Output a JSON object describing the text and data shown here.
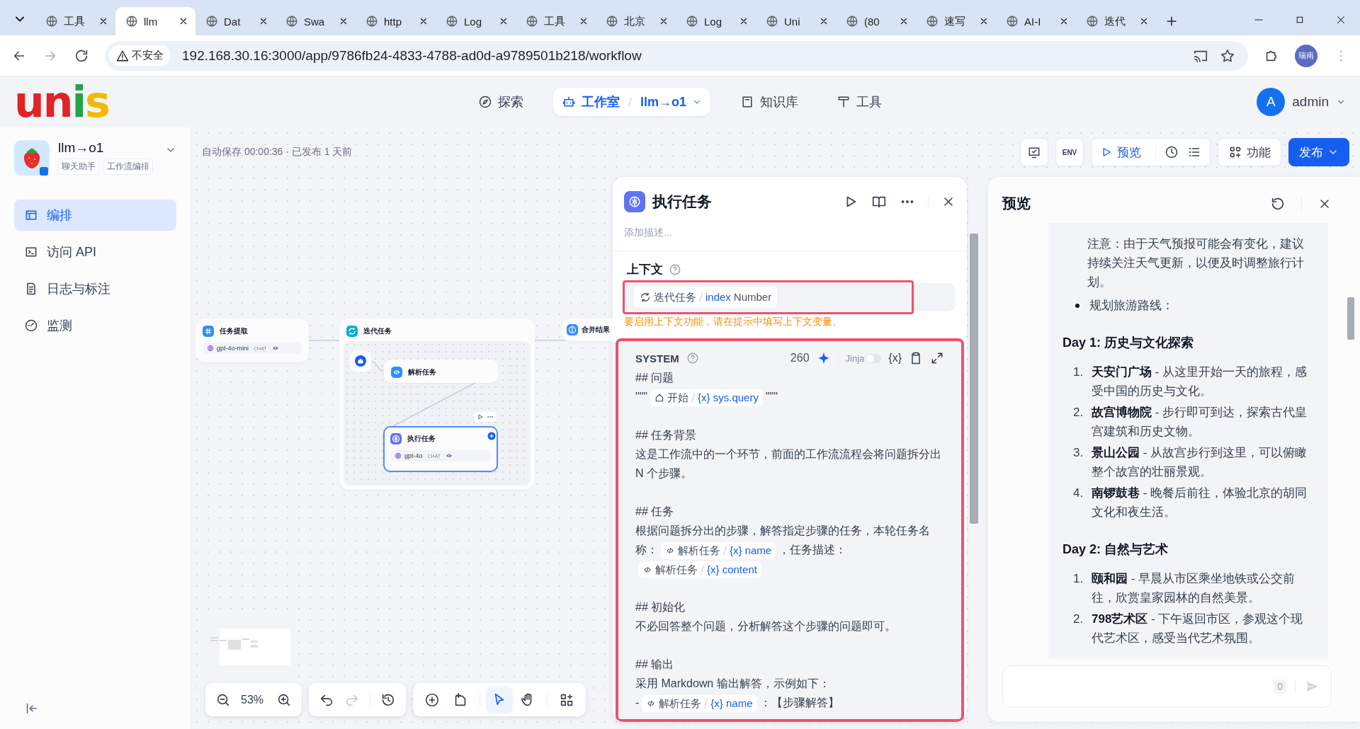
{
  "browser": {
    "tabs": [
      {
        "title": "工具",
        "selected": false
      },
      {
        "title": "llm",
        "selected": true
      },
      {
        "title": "Dat",
        "selected": false
      },
      {
        "title": "Swa",
        "selected": false
      },
      {
        "title": "http",
        "selected": false
      },
      {
        "title": "Log",
        "selected": false
      },
      {
        "title": "工具",
        "selected": false
      },
      {
        "title": "北京",
        "selected": false
      },
      {
        "title": "Log",
        "selected": false
      },
      {
        "title": "Uni",
        "selected": false
      },
      {
        "title": "(80",
        "selected": false
      },
      {
        "title": "速写",
        "selected": false
      },
      {
        "title": "AI-I",
        "selected": false
      },
      {
        "title": "迭代",
        "selected": false
      }
    ],
    "security": "不安全",
    "url": "192.168.30.16:3000/app/9786fb24-4833-4788-ad0d-a9789501b218/workflow",
    "profile": "瑞南"
  },
  "header": {
    "logo": "unis",
    "nav": [
      {
        "label": "探索",
        "selected": false
      },
      {
        "label": "工作室",
        "selected": true,
        "app": "llm→o1"
      },
      {
        "label": "知识库",
        "selected": false
      },
      {
        "label": "工具",
        "selected": false
      }
    ],
    "user": {
      "initial": "A",
      "name": "admin"
    }
  },
  "sidebar": {
    "app": {
      "name": "llm→o1",
      "tags": [
        "聊天助手",
        "工作流编排"
      ]
    },
    "items": [
      {
        "label": "编排",
        "selected": true
      },
      {
        "label": "访问 API",
        "selected": false
      },
      {
        "label": "日志与标注",
        "selected": false
      },
      {
        "label": "监测",
        "selected": false
      }
    ]
  },
  "toolbar": {
    "autosave": "自动保存 00:00:36 · 已发布 1 天前",
    "env": "ENV",
    "preview": "预览",
    "features": "功能",
    "publish": "发布"
  },
  "workflow": {
    "nodes": [
      {
        "kind": "extract",
        "title": "任务提取",
        "model": "gpt-4o-mini",
        "badge": "CHAT",
        "selected": false
      },
      {
        "kind": "iteration",
        "title": "迭代任务",
        "selected": false,
        "children": [
          {
            "kind": "start",
            "selected": false
          },
          {
            "kind": "code",
            "title": "解析任务",
            "selected": false
          },
          {
            "kind": "llm",
            "title": "执行任务",
            "model": "gpt-4o",
            "badge": "CHAT",
            "selected": true
          }
        ]
      },
      {
        "kind": "merge",
        "title": "合并结果",
        "selected": false
      }
    ]
  },
  "canvas_controls": {
    "zoom": "53%",
    "history": [
      {
        "kind": "undo",
        "disabled": false
      },
      {
        "kind": "redo",
        "disabled": true
      },
      {
        "kind": "history",
        "disabled": false
      }
    ],
    "tools": [
      {
        "kind": "add",
        "selected": false
      },
      {
        "kind": "note",
        "selected": false
      },
      {
        "kind": "pointer",
        "selected": true
      },
      {
        "kind": "hand",
        "selected": false
      },
      {
        "kind": "layout",
        "selected": false
      }
    ]
  },
  "panel": {
    "title": "执行任务",
    "description": {
      "placeholder": "添加描述..."
    },
    "context": {
      "label": "上下文",
      "highlighted": true,
      "variable": {
        "node": "迭代任务",
        "name": "index",
        "type": "Number"
      }
    },
    "warning": "要启用上下文功能，请在提示中填写上下文变量。",
    "prompt": {
      "role": "SYSTEM",
      "count": "260",
      "jinja": {
        "label": "Jinja",
        "on": false
      },
      "insert_label": "{x}",
      "highlighted": true,
      "sections": [
        {
          "heading": "## 问题",
          "lines": [
            [
              {
                "kind": "text",
                "text": "\"\"\""
              },
              {
                "kind": "start_var",
                "node": "开始",
                "mark": "{x}",
                "name": "sys.query"
              },
              {
                "kind": "text",
                "text": "\"\"\""
              }
            ]
          ]
        },
        {
          "heading": "## 任务背景",
          "lines": [
            [
              {
                "kind": "text",
                "text": "这是工作流中的一个环节，前面的工作流流程会将问题拆分出 N 个步骤。"
              }
            ]
          ]
        },
        {
          "heading": "## 任务",
          "lines": [
            [
              {
                "kind": "text",
                "text": "根据问题拆分出的步骤，解答指定步骤的任务，本轮任务名称："
              },
              {
                "kind": "code_var",
                "node": "解析任务",
                "mark": "{x}",
                "name": "name"
              },
              {
                "kind": "text",
                "text": "，任务描述："
              },
              {
                "kind": "code_var",
                "node": "解析任务",
                "mark": "{x}",
                "name": "content"
              }
            ]
          ]
        },
        {
          "heading": "## 初始化",
          "lines": [
            [
              {
                "kind": "text",
                "text": "不必回答整个问题，分析解答这个步骤的问题即可。"
              }
            ]
          ]
        },
        {
          "heading": "## 输出",
          "lines": [
            [
              {
                "kind": "text",
                "text": "采用 Markdown 输出解答，示例如下："
              }
            ],
            [
              {
                "kind": "text",
                "text": "-"
              },
              {
                "kind": "code_var",
                "node": "解析任务",
                "mark": "{x}",
                "name": "name"
              },
              {
                "kind": "text",
                "text": "：【步骤解答】"
              }
            ]
          ]
        }
      ]
    }
  },
  "preview": {
    "title": "预览",
    "blocks": [
      {
        "kind": "note",
        "text": "注意：由于天气预报可能会有变化，建议持续关注天气更新，以便及时调整旅行计划。"
      },
      {
        "kind": "bullet",
        "text": "规划旅游路线："
      },
      {
        "kind": "heading",
        "text": "Day 1: 历史与文化探索"
      },
      {
        "kind": "list",
        "items": [
          {
            "number": "1.",
            "text": "**天安门广场** - 从这里开始一天的旅程，感受中国的历史与文化。"
          },
          {
            "number": "2.",
            "text": "**故宫博物院** - 步行即可到达，探索古代皇宫建筑和历史文物。"
          },
          {
            "number": "3.",
            "text": "**景山公园** - 从故宫步行到这里，可以俯瞰整个故宫的壮丽景观。"
          },
          {
            "number": "4.",
            "text": "**南锣鼓巷** - 晚餐后前往，体验北京的胡同文化和夜生活。"
          }
        ]
      },
      {
        "kind": "heading",
        "text": "Day 2: 自然与艺术"
      },
      {
        "kind": "list",
        "items": [
          {
            "number": "1.",
            "text": "**颐和园** - 早晨从市区乘坐地铁或公交前往，欣赏皇家园林的自然美景。"
          },
          {
            "number": "2.",
            "text": "**798艺术区** - 下午返回市区，参观这个现代艺术区，感受当代艺术氛围。"
          }
        ]
      }
    ],
    "input": {
      "count": "0"
    }
  }
}
